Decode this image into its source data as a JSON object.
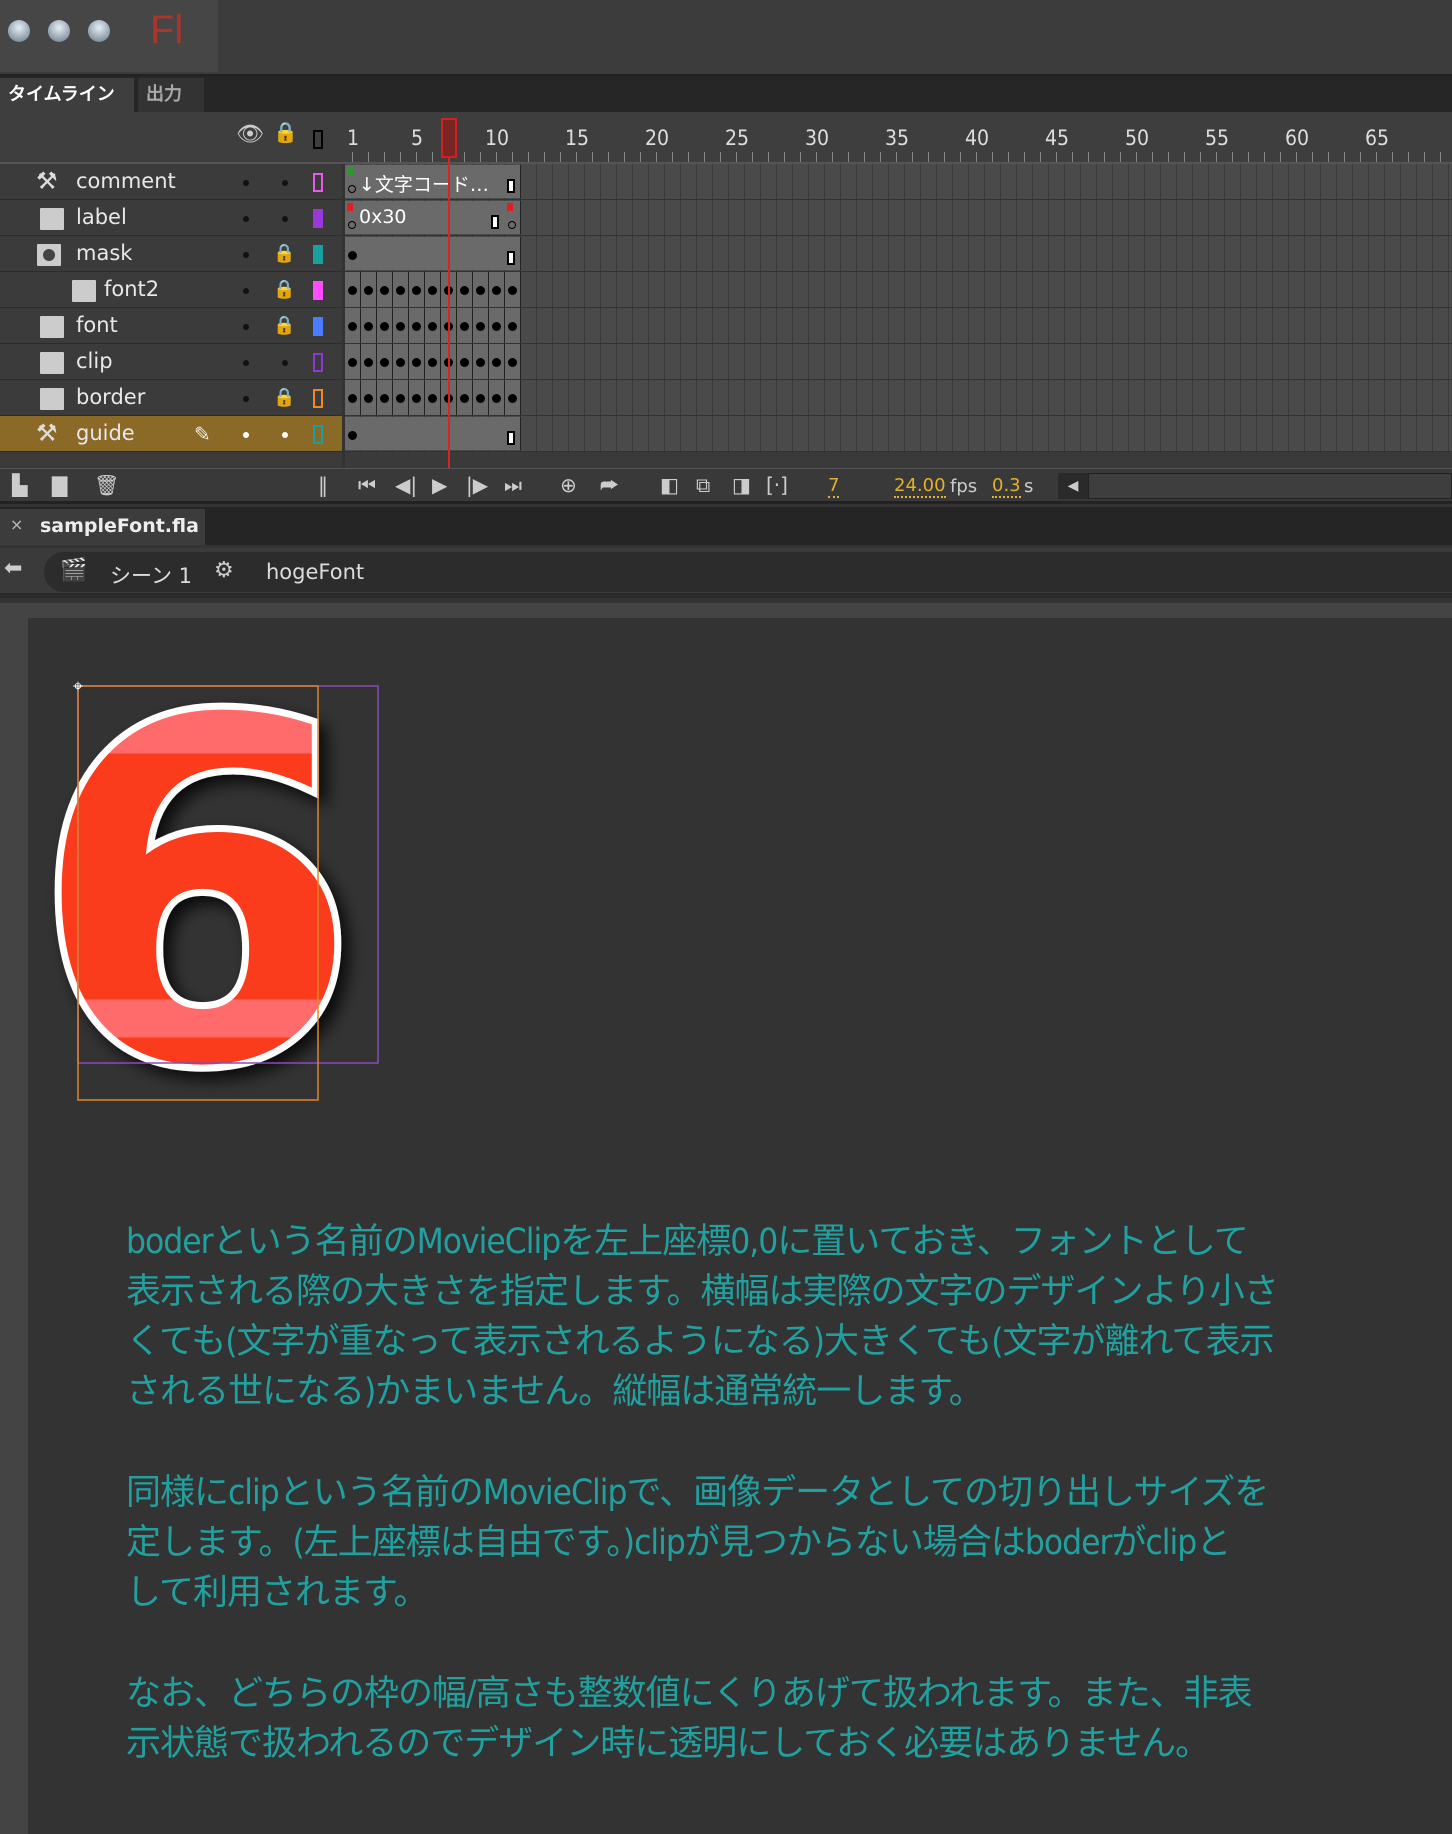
{
  "app": {
    "logo": "Fl"
  },
  "panel_tabs": [
    "タイムライン",
    "出力"
  ],
  "ruler": {
    "labels": [
      "1",
      "5",
      "10",
      "15",
      "20",
      "25",
      "30",
      "35",
      "40",
      "45",
      "50",
      "55",
      "60",
      "65"
    ],
    "current_frame": 7
  },
  "layers": [
    {
      "name": "comment",
      "type": "guide",
      "locked": false,
      "color": "#e65ce6",
      "outline_filled": false,
      "indent": false,
      "frames": "comment",
      "label": "↓文字コード…"
    },
    {
      "name": "label",
      "type": "normal",
      "locked": false,
      "color": "#9a38d8",
      "outline_filled": true,
      "indent": false,
      "frames": "label",
      "label": "0x30"
    },
    {
      "name": "mask",
      "type": "mask",
      "locked": true,
      "color": "#1aa0a0",
      "outline_filled": true,
      "indent": false,
      "frames": "span"
    },
    {
      "name": "font2",
      "type": "masked",
      "locked": true,
      "color": "#ff4cff",
      "outline_filled": true,
      "indent": true,
      "frames": "keys"
    },
    {
      "name": "font",
      "type": "normal",
      "locked": true,
      "color": "#4a7cff",
      "outline_filled": true,
      "indent": false,
      "frames": "keys"
    },
    {
      "name": "clip",
      "type": "normal",
      "locked": false,
      "color": "#8a38d8",
      "outline_filled": false,
      "indent": false,
      "frames": "keys"
    },
    {
      "name": "border",
      "type": "normal",
      "locked": true,
      "color": "#f08a20",
      "outline_filled": false,
      "indent": false,
      "frames": "keys"
    },
    {
      "name": "guide",
      "type": "guide",
      "locked": false,
      "color": "#1aa0a0",
      "outline_filled": false,
      "indent": false,
      "frames": "span",
      "selected": true
    }
  ],
  "timeline_status": {
    "frame": "7",
    "fps_value": "24.00",
    "fps_unit": "fps",
    "time_value": "0.3",
    "time_unit": "s"
  },
  "document_tab": {
    "close": "×",
    "name": "sampleFont.fla"
  },
  "breadcrumb": {
    "scene": "シーン 1",
    "symbol": "hogeFont"
  },
  "stage": {
    "glyph": "6",
    "colors": {
      "fill": "#fa3a1e",
      "stripe": "#ff6b6b",
      "outline": "#ffffff",
      "border_box": "#e0852a",
      "clip_box": "#8a4ab8"
    },
    "paragraphs": [
      [
        "boderという名前のMovieClipを左上座標0,0に置いておき、フォントとして",
        "表示される際の大きさを指定します。横幅は実際の文字のデザインより小さ",
        "くても(文字が重なって表示されるようになる)大きくても(文字が離れて表示",
        "される世になる)かまいません。縦幅は通常統一します。"
      ],
      [
        "同様にclipという名前のMovieClipで、画像データとしての切り出しサイズを",
        "定します。(左上座標は自由です。)clipが見つからない場合はboderがclipと",
        "して利用されます。"
      ],
      [
        "なお、どちらの枠の幅/高さも整数値にくりあげて扱われます。また、非表",
        "示状態で扱われるのでデザイン時に透明にしておく必要はありません。"
      ]
    ]
  }
}
